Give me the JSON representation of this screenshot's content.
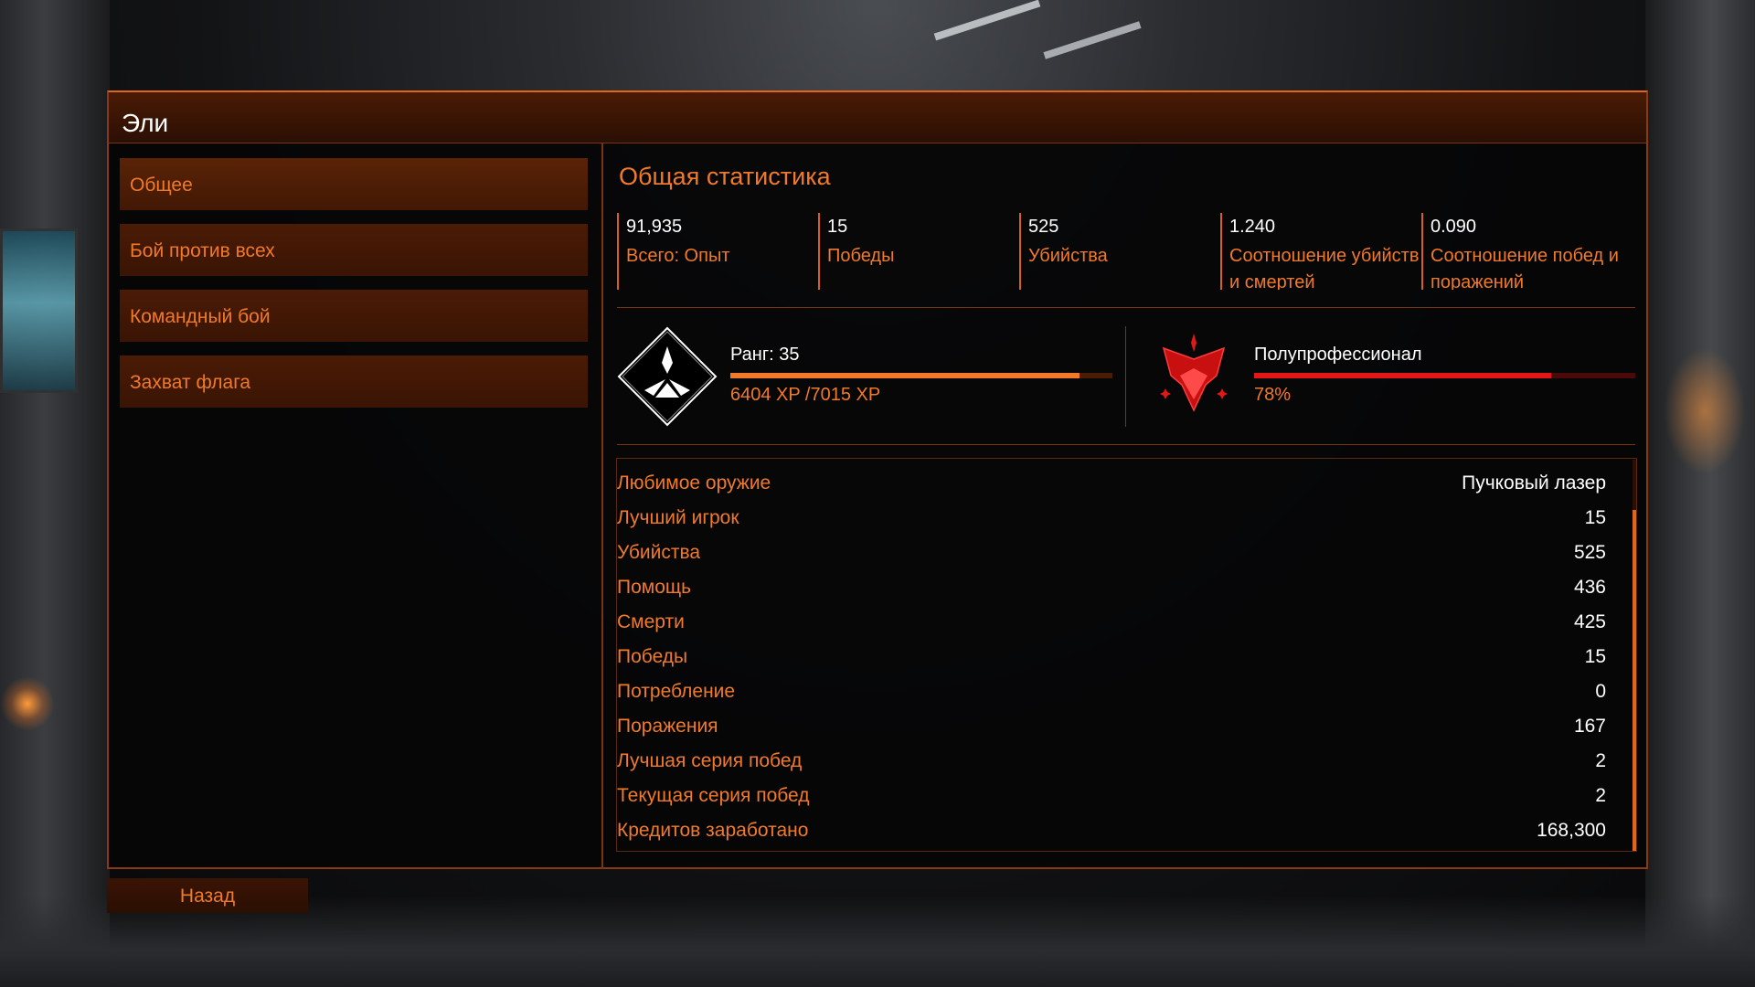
{
  "window": {
    "title": "Эли"
  },
  "menu": {
    "items": [
      {
        "label": "Общее",
        "active": true
      },
      {
        "label": "Бой против всех",
        "active": false
      },
      {
        "label": "Командный бой",
        "active": false
      },
      {
        "label": "Захват флага",
        "active": false
      }
    ]
  },
  "overview": {
    "title": "Общая статистика",
    "stats": [
      {
        "value": "91,935",
        "label": "Всего: Опыт"
      },
      {
        "value": "15",
        "label": "Победы"
      },
      {
        "value": "525",
        "label": "Убийства"
      },
      {
        "value": "1.240",
        "label": "Соотношение убийств и смертей"
      },
      {
        "value": "0.090",
        "label": "Соотношение побед и поражений"
      }
    ]
  },
  "rank": {
    "label": "Ранг: 35",
    "xp_text": "6404 XP /7015 XP",
    "progress": 0.913,
    "icon": "rank-diamond-icon"
  },
  "skill": {
    "label": "Полупрофессионал",
    "percent_text": "78%",
    "progress": 0.78,
    "icon": "skill-emblem-icon"
  },
  "details": {
    "rows": [
      {
        "label": "Любимое оружие",
        "value": "Пучковый лазер"
      },
      {
        "label": "Лучший игрок",
        "value": "15"
      },
      {
        "label": "Убийства",
        "value": "525"
      },
      {
        "label": "Помощь",
        "value": "436"
      },
      {
        "label": "Смерти",
        "value": "425"
      },
      {
        "label": "Победы",
        "value": "15"
      },
      {
        "label": "Потребление",
        "value": "0"
      },
      {
        "label": "Поражения",
        "value": "167"
      },
      {
        "label": "Лучшая серия побед",
        "value": "2"
      },
      {
        "label": "Текущая серия побед",
        "value": "2"
      },
      {
        "label": "Кредитов заработано",
        "value": "168,300"
      }
    ]
  },
  "footer": {
    "back_label": "Назад"
  },
  "colors": {
    "accent": "#f07a2a",
    "border": "#7a3410",
    "skill_bar": "#e21818",
    "text": "#ffffff"
  }
}
